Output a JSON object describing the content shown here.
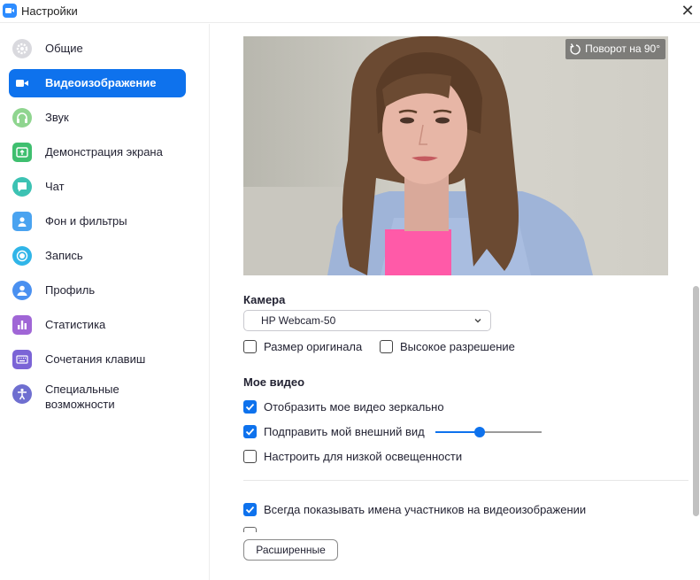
{
  "window": {
    "title": "Настройки"
  },
  "sidebar": {
    "items": [
      {
        "label": "Общие",
        "icon": "gear-icon",
        "color": "#d7d7dc"
      },
      {
        "label": "Видеоизображение",
        "icon": "video-camera-icon",
        "color": "#0e72ed",
        "active": true
      },
      {
        "label": "Звук",
        "icon": "headphones-icon",
        "color": "#8cd48c"
      },
      {
        "label": "Демонстрация экрана",
        "icon": "share-screen-icon",
        "color": "#3fbf6f"
      },
      {
        "label": "Чат",
        "icon": "chat-bubble-icon",
        "color": "#3cc2b3"
      },
      {
        "label": "Фон и фильтры",
        "icon": "person-background-icon",
        "color": "#4aa3f0"
      },
      {
        "label": "Запись",
        "icon": "record-icon",
        "color": "#30b5e8"
      },
      {
        "label": "Профиль",
        "icon": "profile-icon",
        "color": "#4a90f0"
      },
      {
        "label": "Статистика",
        "icon": "bar-chart-icon",
        "color": "#a066d6"
      },
      {
        "label": "Сочетания клавиш",
        "icon": "keyboard-icon",
        "color": "#7b64d6"
      },
      {
        "label": "Специальные возможности",
        "icon": "accessibility-icon",
        "color": "#6f6fd0"
      }
    ]
  },
  "video": {
    "rotate_label": "Поворот на 90°"
  },
  "camera": {
    "title": "Камера",
    "selected": "HP Webcam-50",
    "original_size_label": "Размер оригинала",
    "original_size_checked": false,
    "hd_label": "Высокое разрешение",
    "hd_checked": false
  },
  "my_video": {
    "title": "Мое видео",
    "mirror_label": "Отобразить мое видео зеркально",
    "mirror_checked": true,
    "touch_up_label": "Подправить мой внешний вид",
    "touch_up_checked": true,
    "touch_up_level": 0.42,
    "low_light_label": "Настроить для низкой освещенности",
    "low_light_checked": false
  },
  "always_show_names_label": "Всегда показывать имена участников на видеоизображении",
  "always_show_names_checked": true,
  "advanced_button": "Расширенные",
  "colors": {
    "accent": "#0e72ed"
  }
}
